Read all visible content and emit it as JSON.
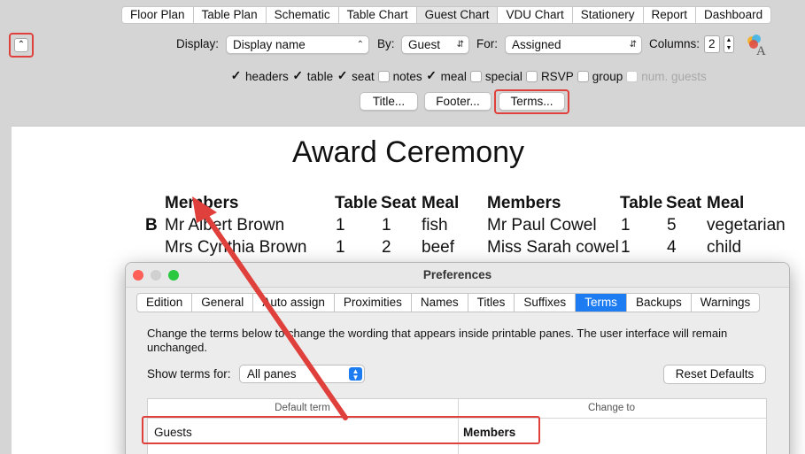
{
  "top_tabs": [
    "Floor Plan",
    "Table Plan",
    "Schematic",
    "Table Chart",
    "Guest Chart",
    "VDU Chart",
    "Stationery",
    "Report",
    "Dashboard"
  ],
  "controls": {
    "display_label": "Display:",
    "display_value": "Display name",
    "by_label": "By:",
    "by_value": "Guest",
    "for_label": "For:",
    "for_value": "Assigned",
    "columns_label": "Columns:",
    "columns_value": "2"
  },
  "checkboxes": [
    {
      "label": "headers",
      "checked": true
    },
    {
      "label": "table",
      "checked": true
    },
    {
      "label": "seat",
      "checked": true
    },
    {
      "label": "notes",
      "checked": false
    },
    {
      "label": "meal",
      "checked": true
    },
    {
      "label": "special",
      "checked": false
    },
    {
      "label": "RSVP",
      "checked": false
    },
    {
      "label": "group",
      "checked": false
    },
    {
      "label": "num. guests",
      "checked": false,
      "disabled": true
    }
  ],
  "buttons": {
    "title": "Title...",
    "footer": "Footer...",
    "terms": "Terms..."
  },
  "document": {
    "title": "Award Ceremony",
    "headers": {
      "members": "Members",
      "table": "Table",
      "seat": "Seat",
      "meal": "Meal"
    },
    "group_letter": "B",
    "left_rows": [
      {
        "name": "Mr Albert Brown",
        "table": "1",
        "seat": "1",
        "meal": "fish"
      },
      {
        "name": "Mrs Cynthia Brown",
        "table": "1",
        "seat": "2",
        "meal": "beef"
      }
    ],
    "right_rows": [
      {
        "name": "Mr Paul Cowel",
        "table": "1",
        "seat": "5",
        "meal": "vegetarian"
      },
      {
        "name": "Miss Sarah cowel",
        "table": "1",
        "seat": "4",
        "meal": "child"
      }
    ]
  },
  "preferences": {
    "title": "Preferences",
    "tabs": [
      "Edition",
      "General",
      "Auto assign",
      "Proximities",
      "Names",
      "Titles",
      "Suffixes",
      "Terms",
      "Backups",
      "Warnings"
    ],
    "selected_tab": "Terms",
    "description": "Change the terms below to change the wording that appears inside printable panes. The user interface will remain unchanged.",
    "show_terms_label": "Show terms for:",
    "show_terms_value": "All panes",
    "reset_button": "Reset Defaults",
    "col_default": "Default term",
    "col_change": "Change to",
    "rows": [
      {
        "default": "Guests",
        "change": "Members"
      }
    ]
  },
  "accent": "#1e7cf2",
  "highlight": "#e0403c"
}
